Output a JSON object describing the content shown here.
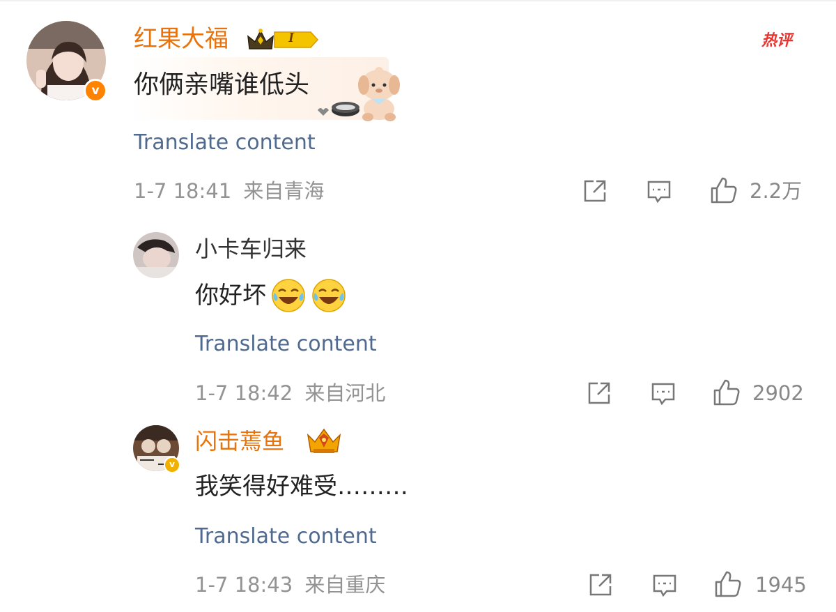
{
  "comments": [
    {
      "username": "红果大福",
      "vip_level": "I",
      "content": "你俩亲嘴谁低头",
      "translate": "Translate content",
      "time": "1-7 18:41",
      "location": "来自青海",
      "likes": "2.2万",
      "tag": "热评"
    },
    {
      "username": "小卡车归来",
      "content": "你好坏",
      "translate": "Translate content",
      "time": "1-7 18:42",
      "location": "来自河北",
      "likes": "2902"
    },
    {
      "username": "闪击蔫鱼",
      "content": "我笑得好难受………",
      "translate": "Translate content",
      "time": "1-7 18:43",
      "location": "来自重庆",
      "likes": "1945"
    }
  ],
  "icons": {
    "repost": "share-icon",
    "comment": "comment-icon",
    "like": "thumbs-up-icon",
    "verified": "verified-badge-icon",
    "crown": "crown-icon",
    "laugh": "laughing-crying-emoji"
  },
  "colors": {
    "username_vip": "#e8730c",
    "translate": "#50698f",
    "meta": "#939393",
    "hot_tag": "#e8332f",
    "verified": "#ff8200"
  }
}
